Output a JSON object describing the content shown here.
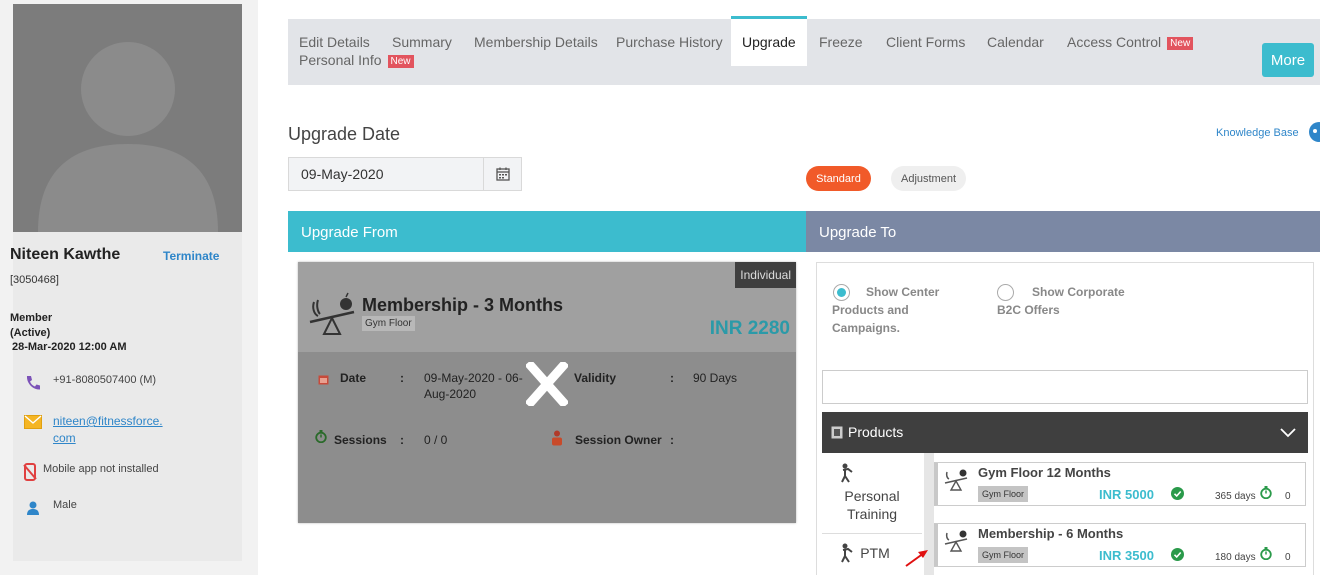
{
  "profile": {
    "name": "Niteen Kawthe",
    "terminate_label": "Terminate",
    "member_id": "[3050468]",
    "member_type_line1": "Member",
    "member_type_line2": "(Active)",
    "member_date": "28-Mar-2020 12:00 AM",
    "phone": "+91-8080507400 (M)",
    "email": "niteen@fitnessforce.com",
    "app_status": "Mobile app not installed",
    "gender": "Male"
  },
  "tabs": [
    {
      "label": "Edit Details"
    },
    {
      "label": "Summary"
    },
    {
      "label": "Membership Details"
    },
    {
      "label": "Purchase History"
    },
    {
      "label": "Upgrade"
    },
    {
      "label": "Freeze"
    },
    {
      "label": "Client Forms"
    },
    {
      "label": "Calendar"
    },
    {
      "label": "Access Control",
      "badge": "New"
    },
    {
      "label": "Personal Info",
      "badge": "New"
    }
  ],
  "more_label": "More",
  "upgrade": {
    "date_label": "Upgrade Date",
    "date_value": "09-May-2020",
    "knowledge_base": "Knowledge Base",
    "standard_label": "Standard",
    "adjustment_label": "Adjustment",
    "from_header": "Upgrade From",
    "to_header": "Upgrade To"
  },
  "from_card": {
    "badge": "Individual",
    "title": "Membership - 3 Months",
    "subtitle": "Gym Floor",
    "price": "INR 2280",
    "date_label": "Date",
    "date_value": "09-May-2020 - 06-Aug-2020",
    "validity_label": "Validity",
    "validity_value": "90 Days",
    "sessions_label": "Sessions",
    "sessions_value": "0 / 0",
    "owner_label": "Session Owner",
    "colon": ":"
  },
  "to_panel": {
    "show_center_label": "Show Center Products and Campaigns.",
    "show_corporate_label": "Show Corporate B2C Offers",
    "products_label": "Products",
    "categories": [
      "Personal Training",
      "PTM"
    ],
    "items": [
      {
        "title": "Gym Floor 12 Months",
        "subtitle": "Gym Floor",
        "price": "INR 5000",
        "days": "365 days",
        "sessions": "0"
      },
      {
        "title": "Membership - 6 Months",
        "subtitle": "Gym Floor",
        "price": "INR 3500",
        "days": "180 days",
        "sessions": "0"
      }
    ]
  },
  "colors": {
    "accent": "#3cbcce",
    "to_header": "#7b88a4",
    "standard": "#f15a29",
    "badge_new": "#e2545e",
    "link": "#2f86c9"
  }
}
